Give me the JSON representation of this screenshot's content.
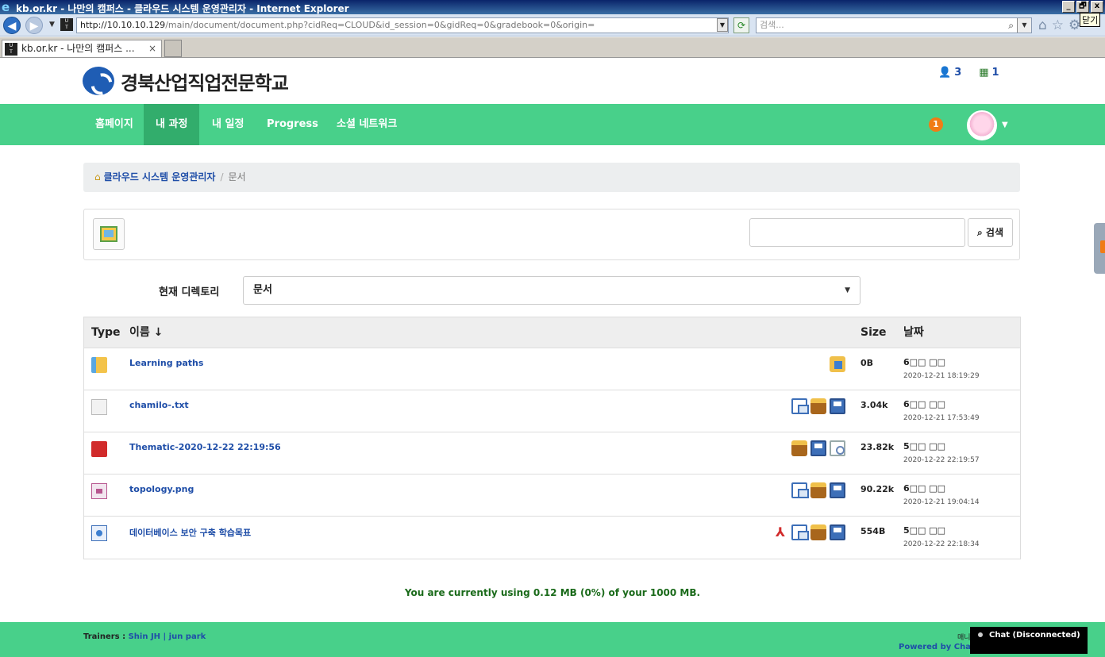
{
  "browser": {
    "window_title": "kb.or.kr - 나만의 캠퍼스 - 클라우드 시스템 운영관리자 - Internet Explorer",
    "url_prefix": "http://10.10.10.129",
    "url_path": "/main/document/document.php?cidReq=CLOUD&id_session=0&gidReq=0&gradebook=0&origin=",
    "search_placeholder": "검색...",
    "tab_title": "kb.or.kr - 나만의 캠퍼스 ...",
    "tab_close": "×",
    "close_tooltip": "닫기",
    "win_min": "_",
    "win_max": "🗗",
    "win_close": "x"
  },
  "site": {
    "logo_text": "경북산업직업전문학교",
    "users_count": "3",
    "online_count": "1"
  },
  "nav": {
    "items": [
      {
        "label": "홈페이지"
      },
      {
        "label": "내 과정"
      },
      {
        "label": "내 일정"
      },
      {
        "label": "Progress"
      },
      {
        "label": "소셜 네트워크"
      }
    ],
    "notification_count": "1"
  },
  "breadcrumb": {
    "course": "클라우드 시스템 운영관리자",
    "separator": "/",
    "current": "문서"
  },
  "toolbar": {
    "search_button": "검색",
    "search_value": ""
  },
  "directory": {
    "label": "현재 디렉토리",
    "selected": "문서"
  },
  "table": {
    "headers": {
      "type": "Type",
      "name": "이름 ↓",
      "size": "Size",
      "date": "날짜"
    },
    "rows": [
      {
        "icon": "folder-icon",
        "name": "Learning paths",
        "size": "0B",
        "date": "6□□ □□",
        "datetime": "2020-12-21 18:19:29",
        "actions": [
          "download-icon"
        ]
      },
      {
        "icon": "text-file-icon",
        "name": "chamilo-.txt",
        "size": "3.04k",
        "date": "6□□ □□",
        "datetime": "2020-12-21 17:53:49",
        "actions": [
          "move-icon",
          "case-icon",
          "save-icon"
        ]
      },
      {
        "icon": "pdf-icon",
        "name": "Thematic-2020-12-22 22:19:56",
        "size": "23.82k",
        "date": "5□□ □□",
        "datetime": "2020-12-22 22:19:57",
        "actions": [
          "case-icon",
          "save-icon",
          "preview-icon"
        ]
      },
      {
        "icon": "image-icon",
        "name": "topology.png",
        "size": "90.22k",
        "date": "6□□ □□",
        "datetime": "2020-12-21 19:04:14",
        "actions": [
          "move-icon",
          "case-icon",
          "save-icon"
        ]
      },
      {
        "icon": "html-icon",
        "name": "데이터베이스 보안 구축 학습목표",
        "size": "554B",
        "date": "5□□ □□",
        "datetime": "2020-12-22 22:18:34",
        "actions": [
          "pdf-export-icon",
          "move-icon",
          "case-icon",
          "save-icon"
        ]
      }
    ]
  },
  "quota_text": "You are currently using 0.12 MB (0%) of your 1000 MB.",
  "footer": {
    "trainers_label": "Trainers :",
    "trainers_names": "Shin JH | jun park",
    "manager_label": "매니",
    "powered": "Powered by Cha"
  },
  "chat": {
    "label": "Chat (Disconnected)"
  }
}
